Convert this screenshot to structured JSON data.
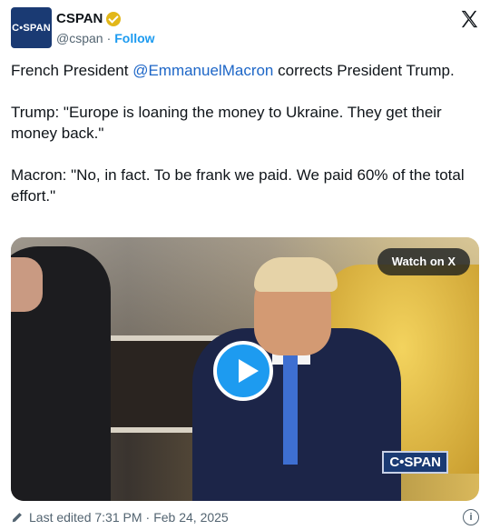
{
  "account": {
    "avatar_text": "C•SPAN",
    "name": "CSPAN",
    "handle": "@cspan",
    "separator": "·",
    "follow_label": "Follow",
    "verified_icon": "gold-verified-badge-icon"
  },
  "post": {
    "lines": [
      {
        "prefix": "French President ",
        "mention": "@EmmanuelMacron",
        "suffix": " corrects President Trump."
      },
      {
        "text": "Trump: \"Europe is loaning the money to Ukraine. They get their money back.\""
      },
      {
        "text": "Macron: \"No, in fact. To be frank we paid. We paid 60% of the total effort.\""
      }
    ]
  },
  "media": {
    "watch_label": "Watch on X",
    "network_bug": "C•SPAN",
    "play_icon": "play-icon"
  },
  "footer": {
    "edited_label": "Last edited 7:31 PM",
    "separator": "·",
    "date": "Feb 24, 2025",
    "info_icon": "info-icon",
    "info_glyph": "i"
  },
  "colors": {
    "accent": "#1d9bf0",
    "mention": "#1d66c7",
    "brand": "#1a3a73",
    "verified": "#e2b719",
    "muted": "#536471"
  }
}
